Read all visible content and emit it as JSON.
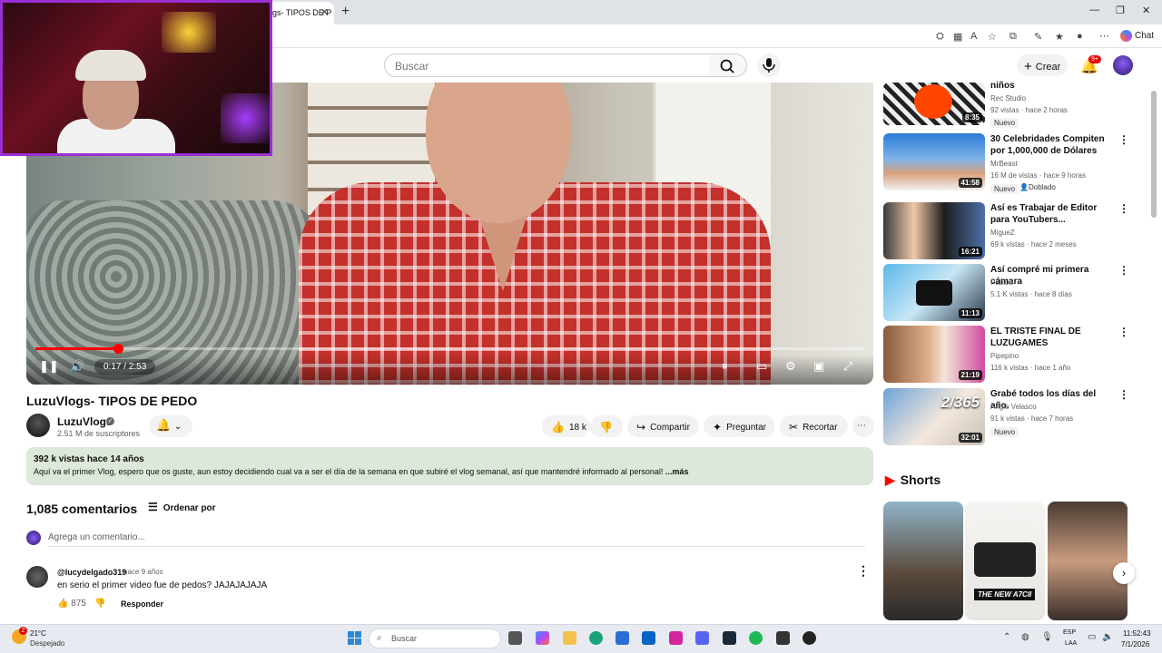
{
  "browser": {
    "tab_title": "gs- TIPOS DE P",
    "chat_label": "Chat"
  },
  "header": {
    "search_placeholder": "Buscar",
    "create_label": "Crear",
    "notif_badge": "9+"
  },
  "player": {
    "time": "0:17 / 2:53",
    "progress": 0.1
  },
  "video": {
    "title": "LuzuVlogs- TIPOS DE PEDO",
    "channel": "LuzuVlogs",
    "subscribers": "2.51 M de suscriptores",
    "likes": "18 k",
    "share_label": "Compartir",
    "ask_label": "Preguntar",
    "clip_label": "Recortar",
    "views_date": "392 k vistas  hace 14 años",
    "description": "Aquí va el primer Vlog, espero que os guste, aun estoy decidiendo cual va a ser el día de la semana en que subiré el vlog semanal, así que mantendré informado al personal!",
    "more_label": "...más"
  },
  "comments": {
    "count": "1,085 comentarios",
    "sort_label": "Ordenar por",
    "add_placeholder": "Agrega un comentario...",
    "items": [
      {
        "user": "@lucydelgado319",
        "time": "hace 9 años",
        "text": "en serio el primer video fue de pedos? JAJAJAJAJA",
        "likes": "875",
        "reply_label": "Responder"
      }
    ]
  },
  "related": [
    {
      "title": "niños",
      "channel": "Rec Studio",
      "meta": "92 vistas · hace 2 horas",
      "duration": "8:35",
      "badge": "Nuevo"
    },
    {
      "title": "30 Celebridades Compiten por 1,000,000 de Dólares",
      "channel": "MrBeast",
      "meta": "16 M de vistas · hace 9 horas",
      "duration": "41:58",
      "badge": "Nuevo",
      "badge2": "Doblado"
    },
    {
      "title": "Así es Trabajar de Editor para YouTubers...",
      "channel": "MigueZ",
      "meta": "69 k vistas · hace 2 meses",
      "duration": "16:21"
    },
    {
      "title": "Así compré mi primera cámara",
      "channel": "Pabloo",
      "meta": "5.1 K vistas · hace 8 días",
      "duration": "11:13"
    },
    {
      "title": "EL TRISTE FINAL DE LUZUGAMES",
      "channel": "Pipepino",
      "meta": "116 k vistas · hace 1 año",
      "duration": "21:19"
    },
    {
      "title": "Grabé todos los días del año.",
      "channel": "Angie Velasco",
      "meta": "91 k vistas · hace 7 horas",
      "duration": "32:01",
      "badge": "Nuevo"
    }
  ],
  "shorts": {
    "title": "Shorts",
    "short2_caption": "THE NEW A7CII"
  },
  "taskbar": {
    "temp": "21°C",
    "weather": "Despejado",
    "weather_badge": "2",
    "search": "Buscar",
    "lang1": "ESP",
    "lang2": "LAA",
    "time": "11:52:43",
    "date": "7/1/2026"
  },
  "colors": {
    "accent_red": "#ff0000",
    "desc_bg": "#dce8d9",
    "webcam_border": "#9a2fd4"
  }
}
